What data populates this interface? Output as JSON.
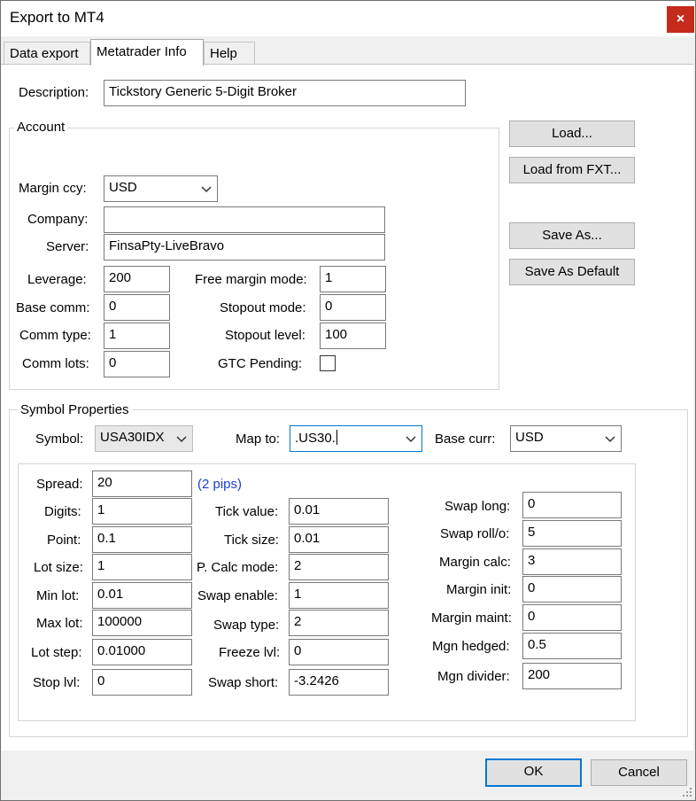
{
  "window": {
    "title": "Export to MT4",
    "close": "×"
  },
  "tabs": [
    {
      "label": "Data export"
    },
    {
      "label": "Metatrader Info"
    },
    {
      "label": "Help"
    }
  ],
  "description": {
    "label": "Description:",
    "value": "Tickstory Generic 5-Digit Broker"
  },
  "account": {
    "title": "Account",
    "margin_ccy": {
      "label": "Margin ccy:",
      "value": "USD"
    },
    "company": {
      "label": "Company:",
      "value": ""
    },
    "server": {
      "label": "Server:",
      "value": "FinsaPty-LiveBravo"
    },
    "leverage": {
      "label": "Leverage:",
      "value": "200"
    },
    "base_comm": {
      "label": "Base comm:",
      "value": "0"
    },
    "comm_type": {
      "label": "Comm type:",
      "value": "1"
    },
    "comm_lots": {
      "label": "Comm lots:",
      "value": "0"
    },
    "free_margin_mode": {
      "label": "Free margin mode:",
      "value": "1"
    },
    "stopout_mode": {
      "label": "Stopout mode:",
      "value": "0"
    },
    "stopout_level": {
      "label": "Stopout level:",
      "value": "100"
    },
    "gtc_pending": {
      "label": "GTC Pending:",
      "checked": false
    }
  },
  "buttons": {
    "load": "Load...",
    "load_fxt": "Load from FXT...",
    "save_as": "Save As...",
    "save_default": "Save As Default",
    "ok": "OK",
    "cancel": "Cancel"
  },
  "symbol": {
    "title": "Symbol Properties",
    "symbol": {
      "label": "Symbol:",
      "value": "USA30IDX"
    },
    "map_to": {
      "label": "Map to:",
      "value": ".US30."
    },
    "base_curr": {
      "label": "Base curr:",
      "value": "USD"
    },
    "spread": {
      "label": "Spread:",
      "value": "20",
      "hint": "(2 pips)"
    },
    "digits": {
      "label": "Digits:",
      "value": "1"
    },
    "point": {
      "label": "Point:",
      "value": "0.1"
    },
    "lot_size": {
      "label": "Lot size:",
      "value": "1"
    },
    "min_lot": {
      "label": "Min lot:",
      "value": "0.01"
    },
    "max_lot": {
      "label": "Max lot:",
      "value": "100000"
    },
    "lot_step": {
      "label": "Lot step:",
      "value": "0.01000"
    },
    "stop_lvl": {
      "label": "Stop lvl:",
      "value": "0"
    },
    "tick_value": {
      "label": "Tick value:",
      "value": "0.01"
    },
    "tick_size": {
      "label": "Tick size:",
      "value": "0.01"
    },
    "p_calc_mode": {
      "label": "P. Calc mode:",
      "value": "2"
    },
    "swap_enable": {
      "label": "Swap enable:",
      "value": "1"
    },
    "swap_type": {
      "label": "Swap type:",
      "value": "2"
    },
    "freeze_lvl": {
      "label": "Freeze lvl:",
      "value": "0"
    },
    "swap_short": {
      "label": "Swap short:",
      "value": "-3.2426"
    },
    "swap_long": {
      "label": "Swap long:",
      "value": "0"
    },
    "swap_rollo": {
      "label": "Swap roll/o:",
      "value": "5"
    },
    "margin_calc": {
      "label": "Margin calc:",
      "value": "3"
    },
    "margin_init": {
      "label": "Margin init:",
      "value": "0"
    },
    "margin_maint": {
      "label": "Margin maint:",
      "value": "0"
    },
    "mgn_hedged": {
      "label": "Mgn hedged:",
      "value": "0.5"
    },
    "mgn_divider": {
      "label": "Mgn divider:",
      "value": "200"
    }
  }
}
